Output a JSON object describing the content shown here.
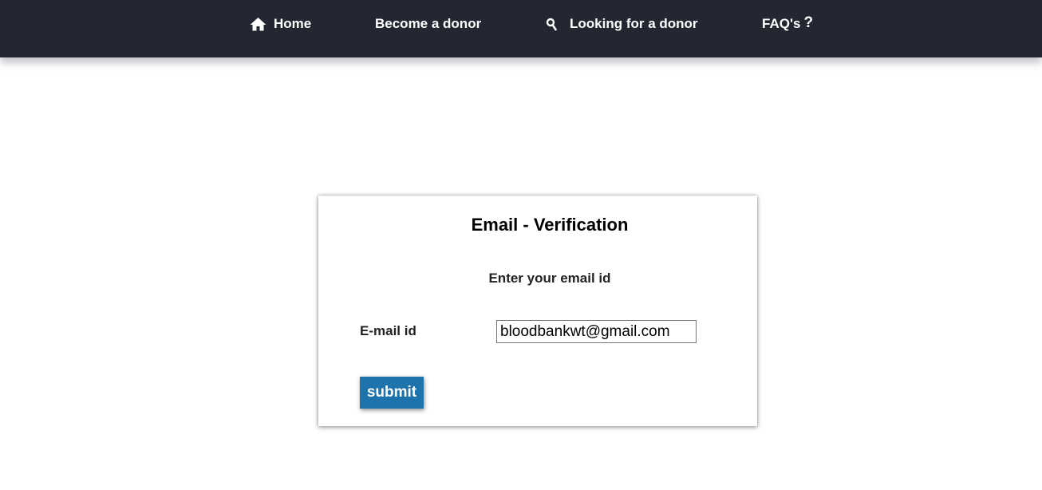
{
  "nav": {
    "home_label": "Home",
    "home_icon": "home-icon",
    "become_donor_label": "Become a donor",
    "looking_label": "Looking for a donor",
    "looking_icon": "search-icon",
    "faq_label": "FAQ's",
    "faq_icon": "help-icon",
    "faq_icon_glyph": "?",
    "background_color": "#222732"
  },
  "form": {
    "title": "Email - Verification",
    "subtitle": "Enter your email id",
    "email_label": "E-mail id",
    "email_value": "bloodbankwt@gmail.com",
    "submit_label": "submit",
    "submit_color": "#1e73ad"
  }
}
